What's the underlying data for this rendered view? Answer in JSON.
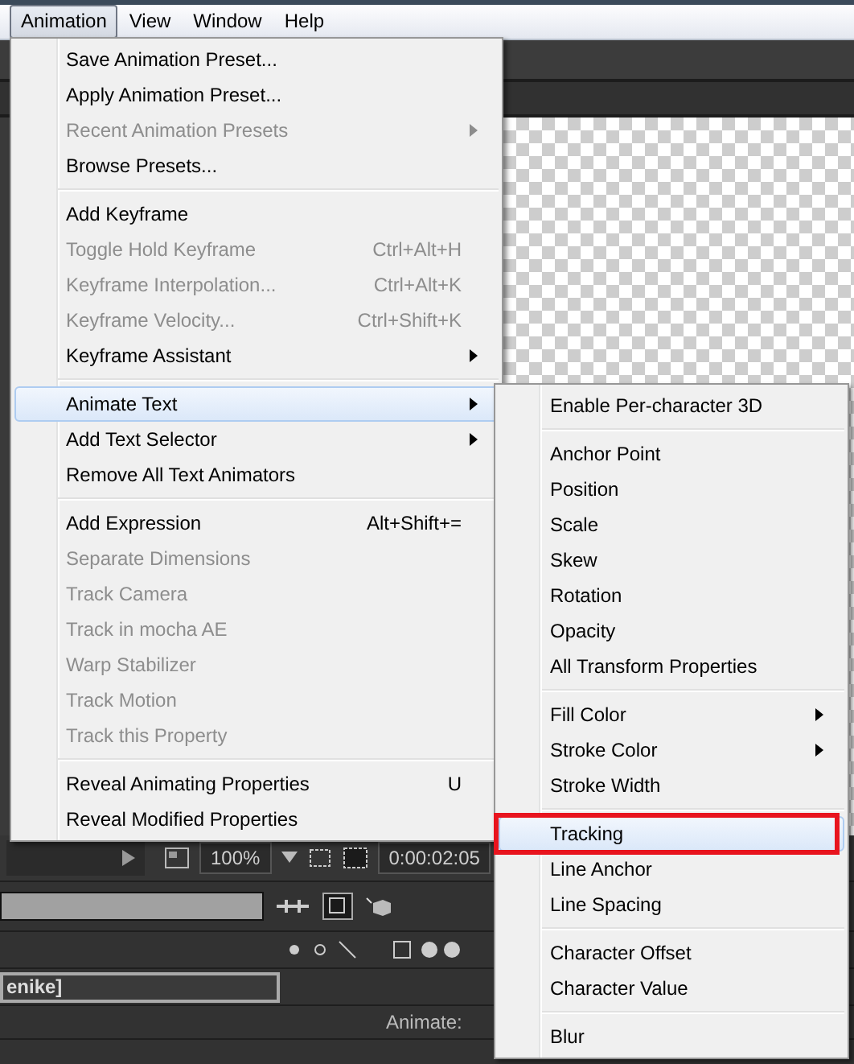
{
  "menu_bar": [
    {
      "label": "Animation",
      "selected": true
    },
    {
      "label": "View",
      "selected": false
    },
    {
      "label": "Window",
      "selected": false
    },
    {
      "label": "Help",
      "selected": false
    }
  ],
  "animation_menu": [
    {
      "kind": "item",
      "label": "Save Animation Preset...",
      "disabled": false,
      "submenu": false,
      "selected": false
    },
    {
      "kind": "item",
      "label": "Apply Animation Preset...",
      "disabled": false,
      "submenu": false,
      "selected": false
    },
    {
      "kind": "item",
      "label": "Recent Animation Presets",
      "disabled": true,
      "submenu": true,
      "selected": false
    },
    {
      "kind": "item",
      "label": "Browse Presets...",
      "disabled": false,
      "submenu": false,
      "selected": false
    },
    {
      "kind": "separator"
    },
    {
      "kind": "item",
      "label": "Add Keyframe",
      "disabled": false,
      "submenu": false,
      "selected": false
    },
    {
      "kind": "item",
      "label": "Toggle Hold Keyframe",
      "shortcut": "Ctrl+Alt+H",
      "disabled": true,
      "submenu": false,
      "selected": false
    },
    {
      "kind": "item",
      "label": "Keyframe Interpolation...",
      "shortcut": "Ctrl+Alt+K",
      "disabled": true,
      "submenu": false,
      "selected": false
    },
    {
      "kind": "item",
      "label": "Keyframe Velocity...",
      "shortcut": "Ctrl+Shift+K",
      "disabled": true,
      "submenu": false,
      "selected": false
    },
    {
      "kind": "item",
      "label": "Keyframe Assistant",
      "disabled": false,
      "submenu": true,
      "selected": false
    },
    {
      "kind": "separator"
    },
    {
      "kind": "item",
      "label": "Animate Text",
      "disabled": false,
      "submenu": true,
      "selected": true
    },
    {
      "kind": "item",
      "label": "Add Text Selector",
      "disabled": false,
      "submenu": true,
      "selected": false
    },
    {
      "kind": "item",
      "label": "Remove All Text Animators",
      "disabled": false,
      "submenu": false,
      "selected": false
    },
    {
      "kind": "separator"
    },
    {
      "kind": "item",
      "label": "Add Expression",
      "shortcut": "Alt+Shift+=",
      "disabled": false,
      "submenu": false,
      "selected": false
    },
    {
      "kind": "item",
      "label": "Separate Dimensions",
      "disabled": true,
      "submenu": false,
      "selected": false
    },
    {
      "kind": "item",
      "label": "Track Camera",
      "disabled": true,
      "submenu": false,
      "selected": false
    },
    {
      "kind": "item",
      "label": "Track in mocha AE",
      "disabled": true,
      "submenu": false,
      "selected": false
    },
    {
      "kind": "item",
      "label": "Warp Stabilizer",
      "disabled": true,
      "submenu": false,
      "selected": false
    },
    {
      "kind": "item",
      "label": "Track Motion",
      "disabled": true,
      "submenu": false,
      "selected": false
    },
    {
      "kind": "item",
      "label": "Track this Property",
      "disabled": true,
      "submenu": false,
      "selected": false
    },
    {
      "kind": "separator"
    },
    {
      "kind": "item",
      "label": "Reveal Animating Properties",
      "shortcut": "U",
      "disabled": false,
      "submenu": false,
      "selected": false
    },
    {
      "kind": "item",
      "label": "Reveal Modified Properties",
      "disabled": false,
      "submenu": false,
      "selected": false
    }
  ],
  "animate_text_submenu": [
    {
      "kind": "item",
      "label": "Enable Per-character 3D",
      "submenu": false,
      "selected": false,
      "outlined": false
    },
    {
      "kind": "separator"
    },
    {
      "kind": "item",
      "label": "Anchor Point",
      "submenu": false,
      "selected": false,
      "outlined": false
    },
    {
      "kind": "item",
      "label": "Position",
      "submenu": false,
      "selected": false,
      "outlined": false
    },
    {
      "kind": "item",
      "label": "Scale",
      "submenu": false,
      "selected": false,
      "outlined": false
    },
    {
      "kind": "item",
      "label": "Skew",
      "submenu": false,
      "selected": false,
      "outlined": false
    },
    {
      "kind": "item",
      "label": "Rotation",
      "submenu": false,
      "selected": false,
      "outlined": false
    },
    {
      "kind": "item",
      "label": "Opacity",
      "submenu": false,
      "selected": false,
      "outlined": false
    },
    {
      "kind": "item",
      "label": "All Transform Properties",
      "submenu": false,
      "selected": false,
      "outlined": false
    },
    {
      "kind": "separator"
    },
    {
      "kind": "item",
      "label": "Fill Color",
      "submenu": true,
      "selected": false,
      "outlined": false
    },
    {
      "kind": "item",
      "label": "Stroke Color",
      "submenu": true,
      "selected": false,
      "outlined": false
    },
    {
      "kind": "item",
      "label": "Stroke Width",
      "submenu": false,
      "selected": false,
      "outlined": false
    },
    {
      "kind": "separator"
    },
    {
      "kind": "item",
      "label": "Tracking",
      "submenu": false,
      "selected": true,
      "outlined": true
    },
    {
      "kind": "item",
      "label": "Line Anchor",
      "submenu": false,
      "selected": false,
      "outlined": false
    },
    {
      "kind": "item",
      "label": "Line Spacing",
      "submenu": false,
      "selected": false,
      "outlined": false
    },
    {
      "kind": "separator"
    },
    {
      "kind": "item",
      "label": "Character Offset",
      "submenu": false,
      "selected": false,
      "outlined": false
    },
    {
      "kind": "item",
      "label": "Character Value",
      "submenu": false,
      "selected": false,
      "outlined": false
    },
    {
      "kind": "separator"
    },
    {
      "kind": "item",
      "label": "Blur",
      "submenu": false,
      "selected": false,
      "outlined": false
    }
  ],
  "viewer_toolbar": {
    "zoom": "100%",
    "timecode": "0:00:02:05"
  },
  "timeline": {
    "layer_name": "enike]",
    "animate_label": "Animate:"
  }
}
